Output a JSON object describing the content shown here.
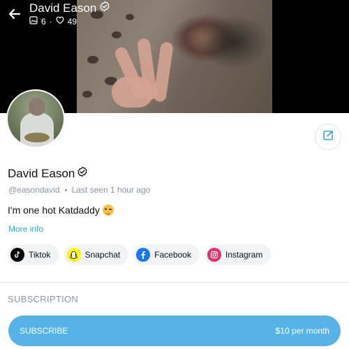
{
  "header": {
    "title": "David Eason",
    "posts_count": "6",
    "likes_count": "49"
  },
  "profile": {
    "name": "David Eason",
    "handle": "@easondavid",
    "last_seen": "Last seen 1 hour ago",
    "bio": "I'm one hot Katdaddy",
    "more_info": "More info"
  },
  "socials": [
    {
      "label": "Tiktok",
      "icon": "tiktok-icon"
    },
    {
      "label": "Snapchat",
      "icon": "snapchat-icon"
    },
    {
      "label": "Facebook",
      "icon": "facebook-icon"
    },
    {
      "label": "Instagram",
      "icon": "instagram-icon"
    }
  ],
  "subscription": {
    "heading": "SUBSCRIPTION",
    "button_label": "SUBSCRIBE",
    "price": "$10 per month"
  },
  "colors": {
    "accent": "#56b3e8",
    "link": "#2fa6e4",
    "muted": "#8a96a3"
  }
}
